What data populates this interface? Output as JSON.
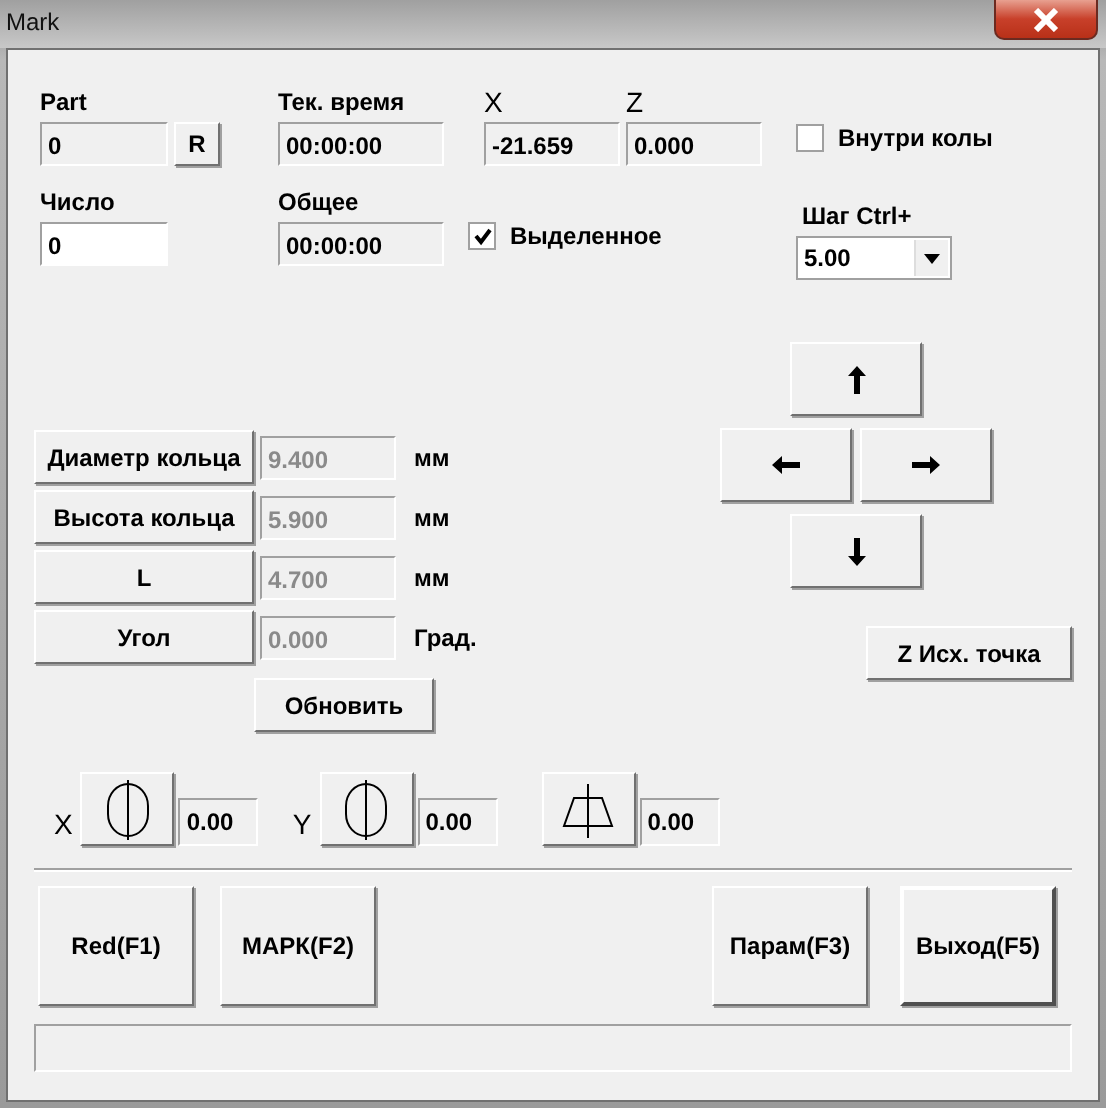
{
  "window": {
    "title": "Mark"
  },
  "part": {
    "label": "Part",
    "value": "0",
    "reset_button": "R"
  },
  "count": {
    "label": "Число",
    "value": "0"
  },
  "current_time": {
    "label": "Тек. время",
    "value": "00:00:00"
  },
  "total_time": {
    "label": "Общее",
    "value": "00:00:00"
  },
  "coords": [
    {
      "label": "X",
      "value": "-21.659"
    },
    {
      "label": "Z",
      "value": "0.000"
    }
  ],
  "selected_only": {
    "label": "Выделенное",
    "checked": true
  },
  "inside_ring": {
    "label": "Внутри колы",
    "checked": false
  },
  "step": {
    "label": "Шаг Ctrl+",
    "value": "5.00"
  },
  "params": [
    {
      "button": "Диаметр кольца",
      "value": "9.400",
      "unit": "мм"
    },
    {
      "button": "Высота кольца",
      "value": "5.900",
      "unit": "мм"
    },
    {
      "button": "L",
      "value": "4.700",
      "unit": "мм"
    },
    {
      "button": "Угол",
      "value": "0.000",
      "unit": "Град."
    }
  ],
  "update_button": "Обновить",
  "z_origin_button": "Z Исх. точка",
  "offsets": [
    {
      "label": "X",
      "kind": "ellipse",
      "value": "0.00"
    },
    {
      "label": "Y",
      "kind": "ellipse",
      "value": "0.00"
    },
    {
      "kind": "trapezoid",
      "value": "0.00"
    }
  ],
  "left_actions": [
    {
      "label": "Red(F1)",
      "default": false
    },
    {
      "label": "МАРК(F2)",
      "default": false
    }
  ],
  "right_actions": [
    {
      "label": "Парам(F3)",
      "default": false
    },
    {
      "label": "Выход(F5)",
      "default": true
    }
  ]
}
